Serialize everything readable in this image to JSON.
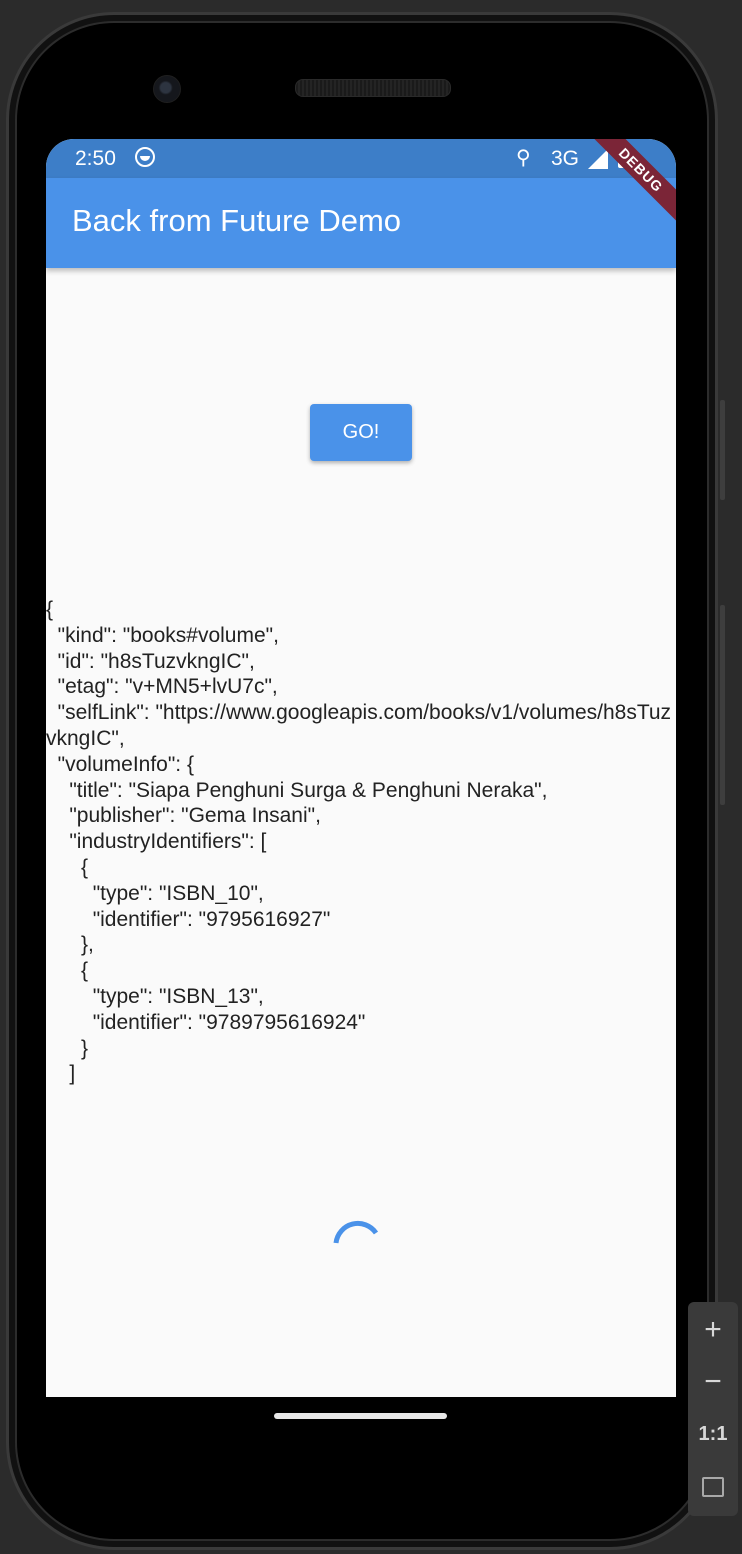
{
  "status_bar": {
    "time": "2:50",
    "network": "3G",
    "face_icon": "android-face-icon",
    "location_icon": "location-pin-icon",
    "signal_icon": "cell-signal-icon",
    "battery_icon": "battery-icon"
  },
  "app_bar": {
    "title": "Back from Future Demo",
    "color": "#4a92e9"
  },
  "debug_banner": {
    "label": "DEBUG",
    "color": "#7b2537"
  },
  "main": {
    "go_button_label": "GO!",
    "json_output": "{\n  \"kind\": \"books#volume\",\n  \"id\": \"h8sTuzvkngIC\",\n  \"etag\": \"v+MN5+lvU7c\",\n  \"selfLink\": \"https://www.googleapis.com/books/v1/volumes/h8sTuzvkngIC\",\n  \"volumeInfo\": {\n    \"title\": \"Siapa Penghuni Surga & Penghuni Neraka\",\n    \"publisher\": \"Gema Insani\",\n    \"industryIdentifiers\": [\n      {\n        \"type\": \"ISBN_10\",\n        \"identifier\": \"9795616927\"\n      },\n      {\n        \"type\": \"ISBN_13\",\n        \"identifier\": \"9789795616924\"\n      }\n    ]",
    "spinner_icon": "loading-spinner-icon"
  },
  "emulator_toolbar": {
    "zoom_in": "+",
    "zoom_out": "−",
    "actual_size": "1:1",
    "fit_icon": "fit-screen-icon"
  }
}
